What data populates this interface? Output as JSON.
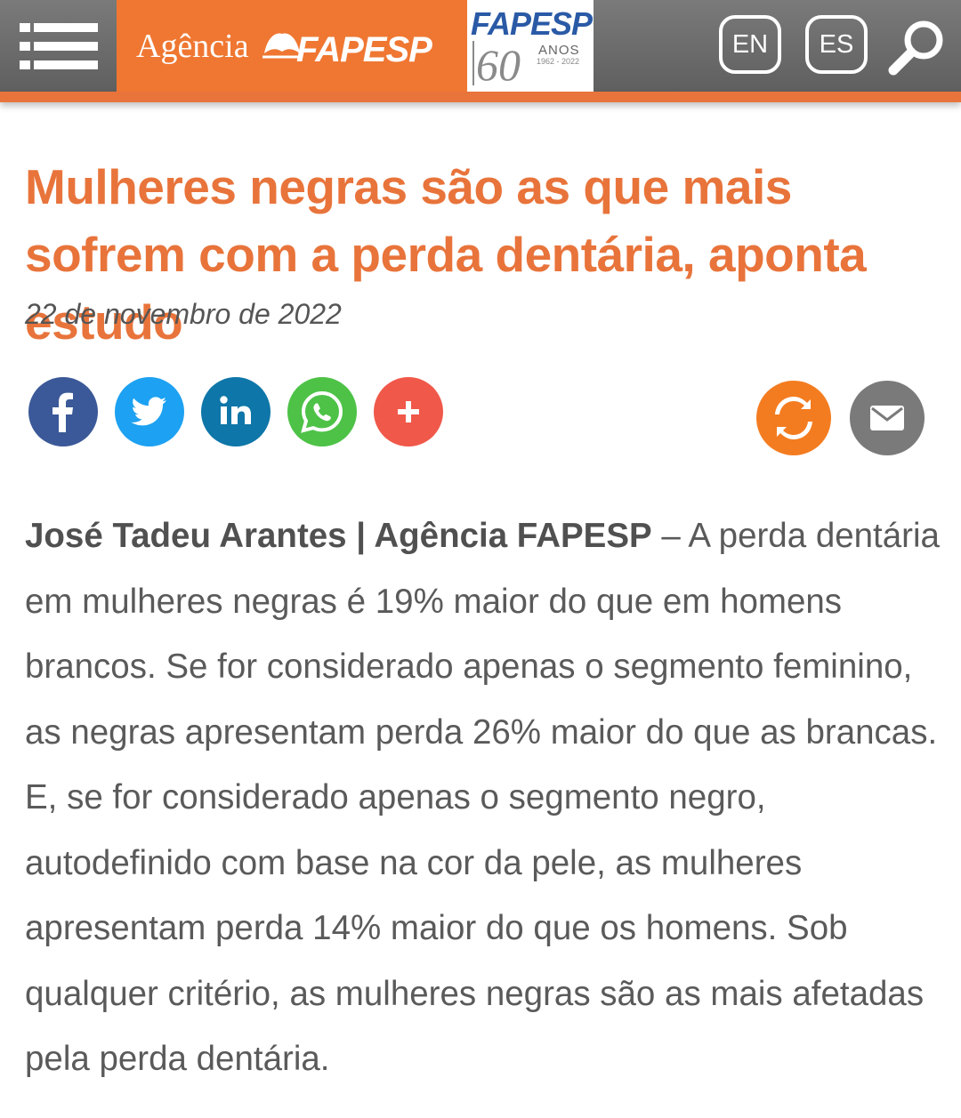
{
  "header": {
    "brand_agencia": "Agência",
    "brand_fapesp": "FAPESP",
    "brand60_name": "FAPESP",
    "brand60_number": "60",
    "brand60_anos": "ANOS",
    "brand60_years": "1962 - 2022",
    "lang_en": "EN",
    "lang_es": "ES",
    "colors": {
      "bar": "#6b6b6b",
      "accent": "#e8743b",
      "fapesp_blue": "#2a5aa6"
    },
    "icons": [
      "hamburger-menu-icon",
      "book-logo-icon",
      "search-icon"
    ]
  },
  "article": {
    "title": "Mulheres negras são as que mais sofrem com a perda dentária, aponta estudo",
    "date": "22 de novembro de 2022",
    "byline": "José Tadeu Arantes | Agência FAPESP",
    "separator": " – ",
    "body": "A perda dentária em mulheres negras é 19% maior do que em homens brancos. Se for considerado apenas o segmento feminino, as negras apresentam perda 26% maior do que as brancas. E, se for considerado apenas o segmento negro, autodefinido com base na cor da pele, as mulheres apresentam perda 14% maior do que os homens. Sob qualquer critério, as mulheres negras são as mais afetadas pela perda dentária."
  },
  "share": {
    "buttons": [
      {
        "name": "facebook",
        "icon": "facebook-icon",
        "color": "#3b5998"
      },
      {
        "name": "twitter",
        "icon": "twitter-icon",
        "color": "#1da1f2"
      },
      {
        "name": "linkedin",
        "icon": "linkedin-icon",
        "color": "#0e76a8"
      },
      {
        "name": "whatsapp",
        "icon": "whatsapp-icon",
        "color": "#4dc247"
      },
      {
        "name": "more",
        "icon": "plus-icon",
        "color": "#f0584a"
      }
    ],
    "actions": [
      {
        "name": "refresh",
        "icon": "refresh-icon",
        "color": "#f47c20"
      },
      {
        "name": "email",
        "icon": "envelope-icon",
        "color": "#7a7a7a"
      }
    ]
  }
}
